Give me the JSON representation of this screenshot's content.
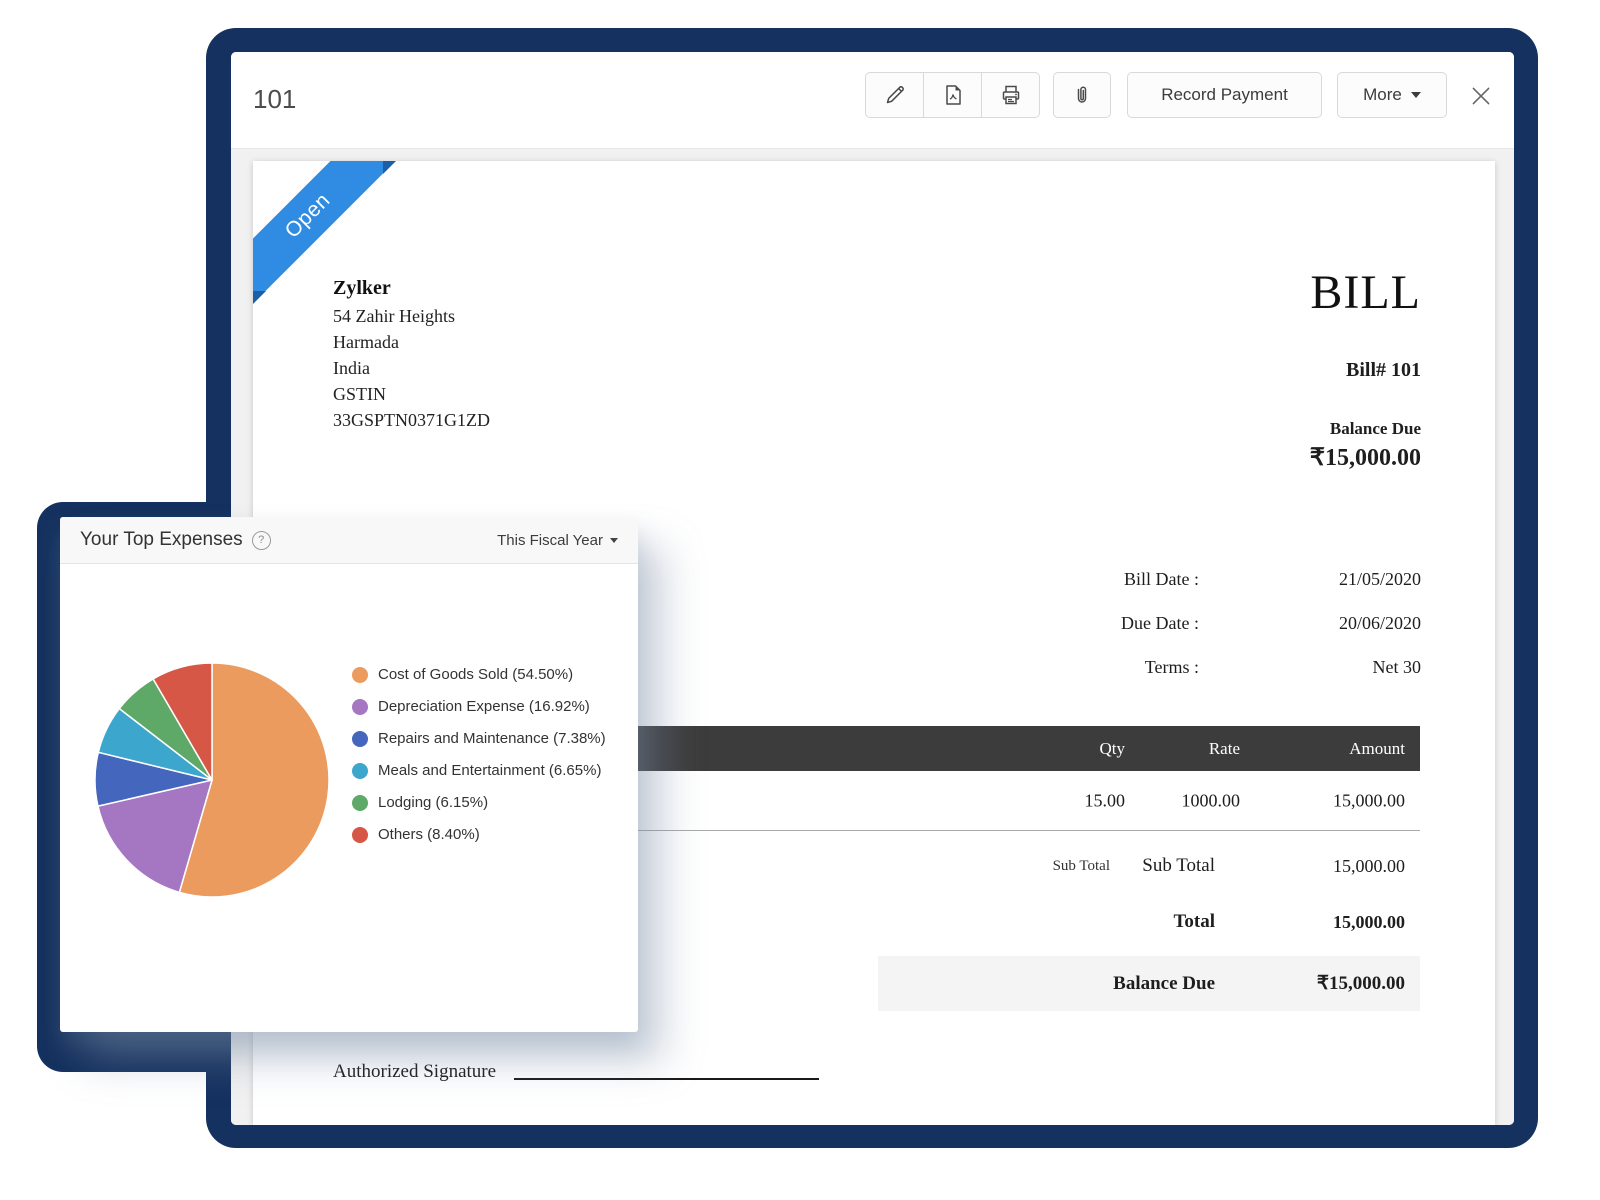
{
  "toolbar": {
    "title": "101",
    "record_payment_label": "Record Payment",
    "more_label": "More"
  },
  "bill": {
    "status": "Open",
    "company": {
      "name": "Zylker",
      "address_lines": [
        "54 Zahir Heights",
        "Harmada",
        "India",
        "GSTIN",
        "33GSPTN0371G1ZD"
      ]
    },
    "doc_title": "BILL",
    "bill_number": "Bill# 101",
    "balance_due_label": "Balance Due",
    "balance_due_value": "₹15,000.00",
    "meta": [
      {
        "label": "Bill Date :",
        "value": "21/05/2020"
      },
      {
        "label": "Due Date :",
        "value": "20/06/2020"
      },
      {
        "label": "Terms :",
        "value": "Net 30"
      }
    ],
    "table": {
      "headers": [
        "Qty",
        "Rate",
        "Amount"
      ],
      "rows": [
        [
          "15.00",
          "1000.00",
          "15,000.00"
        ]
      ]
    },
    "totals": {
      "sub_total_small_label": "Sub Total",
      "sub_total_label": "Sub Total",
      "sub_total_value": "15,000.00",
      "total_label": "Total",
      "total_value": "15,000.00",
      "balance_due_label": "Balance Due",
      "balance_due_value": "₹15,000.00"
    },
    "signature_label": "Authorized Signature"
  },
  "expenses_card": {
    "title": "Your Top Expenses",
    "help_icon": "?",
    "period_selector": "This Fiscal Year"
  },
  "chart_data": {
    "type": "pie",
    "title": "Your Top Expenses",
    "period": "This Fiscal Year",
    "legend_position": "right",
    "start_angle_deg": 0,
    "direction": "clockwise",
    "slices": [
      {
        "label": "Cost of Goods Sold",
        "value": 54.5,
        "color": "#EC9B5F",
        "legend": "Cost of Goods Sold (54.50%)"
      },
      {
        "label": "Depreciation Expense",
        "value": 16.92,
        "color": "#A577C3",
        "legend": "Depreciation Expense (16.92%)"
      },
      {
        "label": "Repairs and Maintenance",
        "value": 7.38,
        "color": "#4566BD",
        "legend": "Repairs and Maintenance (7.38%)"
      },
      {
        "label": "Meals and Entertainment",
        "value": 6.65,
        "color": "#3CA6CD",
        "legend": "Meals and Entertainment (6.65%)"
      },
      {
        "label": "Lodging",
        "value": 6.15,
        "color": "#5EA967",
        "legend": "Lodging (6.15%)"
      },
      {
        "label": "Others",
        "value": 8.4,
        "color": "#D65745",
        "legend": "Others (8.40%)"
      }
    ]
  },
  "colors": {
    "frame_navy": "#15315F",
    "ribbon_blue": "#2F8CE2",
    "ribbon_fold": "#1B5FA8",
    "table_header_bg": "#3C3C3C",
    "balance_band_bg": "#F4F4F4"
  }
}
